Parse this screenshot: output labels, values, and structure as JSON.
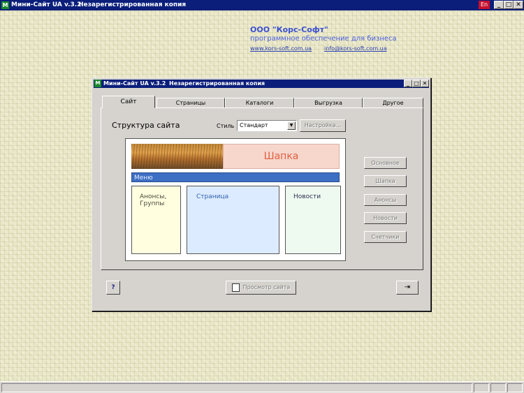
{
  "topbar": {
    "title": "Мини-Сайт UA v.3.2",
    "subtitle": "Незарегистрированная копия",
    "app_icon_glyph": "M",
    "language": "En",
    "minimize": "_",
    "maximize": "□",
    "close": "✕"
  },
  "company": {
    "name": "ООО \"Корс-Софт\"",
    "tagline": "программное обеспечение для бизнеса",
    "website": "www.kors-soft.com.ua",
    "email": "info@kors-soft.com.ua"
  },
  "dialog": {
    "title": "Мини-Сайт UA v.3.2",
    "subtitle": "Незарегистрированная копия",
    "app_icon_glyph": "M",
    "minimize": "_",
    "maximize": "□",
    "close": "✕",
    "tabs": [
      {
        "label": "Сайт"
      },
      {
        "label": "Страницы"
      },
      {
        "label": "Каталоги"
      },
      {
        "label": "Выгрузка"
      },
      {
        "label": "Другое"
      }
    ],
    "structure_label": "Структура сайта",
    "style_label": "Стиль",
    "style_value": "Стандарт",
    "dropdown_glyph": "▼",
    "settings_button": "Настройка...",
    "preview": {
      "header": "Шапка",
      "menu": "Меню",
      "left_column": "Анонсы, Группы",
      "middle_column": "Страница",
      "right_column": "Новости"
    },
    "side_buttons": [
      "Основное",
      "Шапка",
      "Анонсы",
      "Новости",
      "Счетчики"
    ],
    "help_button": "?",
    "preview_button": "Просмотр сайта",
    "exit_glyph": "⇥"
  },
  "colors": {
    "titlebar": "#0a1e7a",
    "desktop": "#e9e7c7",
    "menu_bar": "#3d6fc4",
    "header_text": "#e06040",
    "company_text": "#3a4fd0"
  }
}
